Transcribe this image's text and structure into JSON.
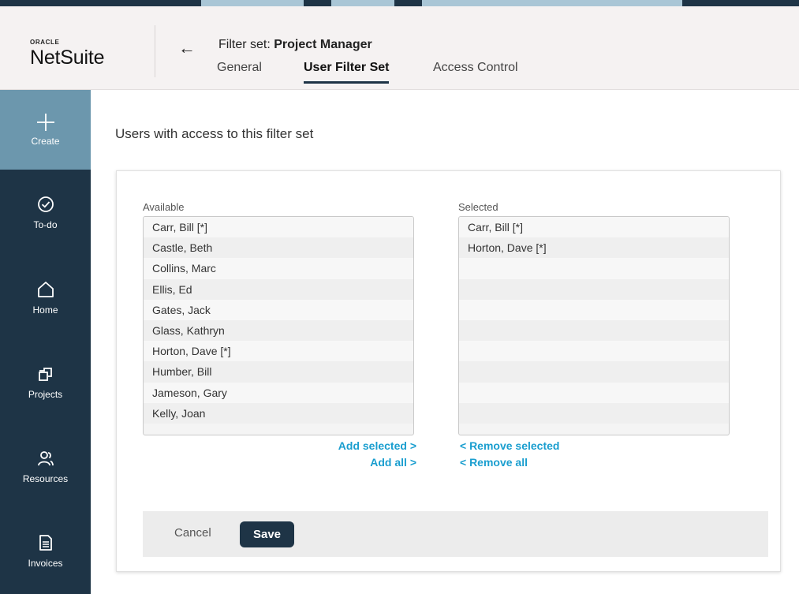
{
  "app": {
    "brand_top": "ORACLE",
    "brand_name": "NetSuite"
  },
  "header": {
    "title_prefix": "Filter set: ",
    "title_value": "Project Manager",
    "tabs": [
      {
        "label": "General",
        "active": false
      },
      {
        "label": "User Filter Set",
        "active": true
      },
      {
        "label": "Access Control",
        "active": false
      }
    ]
  },
  "sidebar": {
    "items": [
      {
        "label": "Create",
        "icon": "plus-icon"
      },
      {
        "label": "To-do",
        "icon": "check-circle-icon"
      },
      {
        "label": "Home",
        "icon": "home-icon"
      },
      {
        "label": "Projects",
        "icon": "projects-icon"
      },
      {
        "label": "Resources",
        "icon": "people-icon"
      },
      {
        "label": "Invoices",
        "icon": "invoice-icon"
      }
    ]
  },
  "main": {
    "title": "Users with access to this filter set",
    "available": {
      "label": "Available",
      "items": [
        "Carr, Bill [*]",
        "Castle, Beth",
        "Collins, Marc",
        "Ellis, Ed",
        "Gates, Jack",
        "Glass, Kathryn",
        "Horton, Dave [*]",
        "Humber, Bill",
        "Jameson, Gary",
        "Kelly, Joan"
      ]
    },
    "selected": {
      "label": "Selected",
      "items": [
        "Carr, Bill [*]",
        "Horton, Dave [*]"
      ]
    },
    "links": {
      "add_selected": "Add selected >",
      "add_all": "Add all >",
      "remove_selected": "< Remove selected",
      "remove_all": "< Remove all"
    },
    "footer": {
      "cancel": "Cancel",
      "save": "Save"
    }
  },
  "colors": {
    "navy": "#1e3446",
    "accent_blue": "#6c97ad",
    "link": "#1a9ecf"
  }
}
